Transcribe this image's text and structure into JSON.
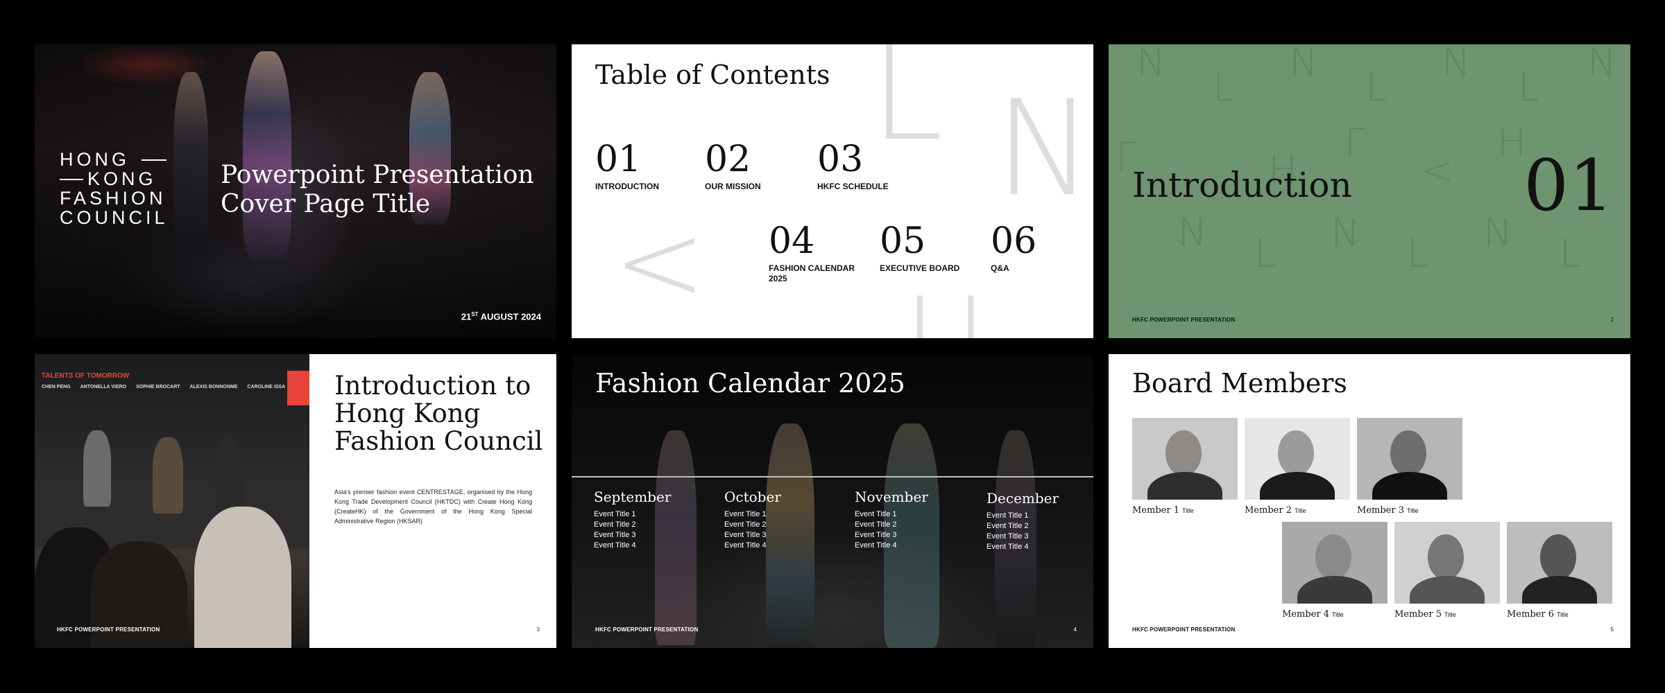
{
  "slide1": {
    "logo_lines": [
      "HONG",
      "KONG",
      "FASHION",
      "COUNCIL"
    ],
    "title": "Powerpoint Presentation Cover Page Title",
    "date_day": "21",
    "date_suffix": "ST",
    "date_rest": " AUGUST 2024"
  },
  "slide2": {
    "title": "Table of Contents",
    "items": [
      {
        "num": "01",
        "label": "INTRODUCTION"
      },
      {
        "num": "02",
        "label": "OUR MISSION"
      },
      {
        "num": "03",
        "label": "HKFC SCHEDULE"
      },
      {
        "num": "04",
        "label": "FASHION CALENDAR 2025"
      },
      {
        "num": "05",
        "label": "EXECUTIVE BOARD"
      },
      {
        "num": "06",
        "label": "Q&A"
      }
    ]
  },
  "slide3": {
    "title": "Introduction",
    "number": "01",
    "footer": "HKFC POWERPOINT PRESENTATION",
    "page": "2"
  },
  "slide4": {
    "banner": "TALENTS OF TOMORROW",
    "panelists": [
      "CHEN PENG",
      "ANTONELLA VIERO",
      "SOPHIE BROCART",
      "ALEXIS BONNONME",
      "CAROLINE ISSA"
    ],
    "title": "Introduction to Hong Kong Fashion Council",
    "body": "Asia's premier fashion event CENTRESTAGE, organised by the Hong Kong Trade Development Council (HKTDC) with Create Hong Kong (CreateHK) of the Government of the Hong Kong Special Administrative Region (HKSAR)",
    "footer": "HKFC POWERPOINT PRESENTATION",
    "page": "3"
  },
  "slide5": {
    "title": "Fashion Calendar 2025",
    "months": [
      {
        "name": "September",
        "events": [
          "Event Title 1",
          "Event Title 2",
          "Event Title 3",
          "Event Title 4"
        ]
      },
      {
        "name": "October",
        "events": [
          "Event Title 1",
          "Event Title 2",
          "Event Title 3",
          "Event Title 4"
        ]
      },
      {
        "name": "November",
        "events": [
          "Event Title 1",
          "Event Title 2",
          "Event Title 3",
          "Event Title 4"
        ]
      },
      {
        "name": "December",
        "events": [
          "Event Title 1",
          "Event Title 2",
          "Event Title 3",
          "Event Title 4"
        ]
      }
    ],
    "footer": "HKFC POWERPOINT PRESENTATION",
    "page": "4"
  },
  "slide6": {
    "title": "Board Members",
    "members": [
      {
        "name": "Member 1",
        "title": "Title"
      },
      {
        "name": "Member 2",
        "title": "Title"
      },
      {
        "name": "Member 3",
        "title": "Title"
      },
      {
        "name": "Member 4",
        "title": "Title"
      },
      {
        "name": "Member 5",
        "title": "Title"
      },
      {
        "name": "Member 6",
        "title": "Title"
      }
    ],
    "footer": "HKFC POWERPOINT PRESENTATION",
    "page": "5"
  }
}
